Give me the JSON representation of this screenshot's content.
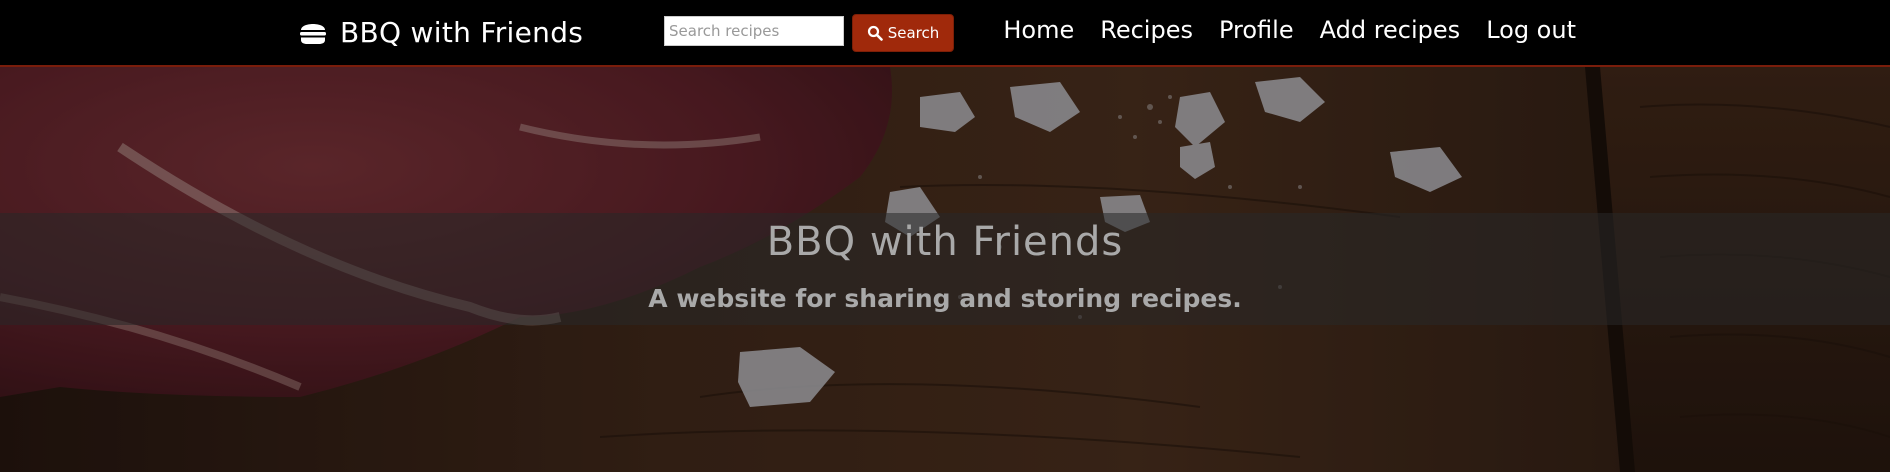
{
  "navbar": {
    "brand": {
      "icon": "hamburger-icon",
      "label": "BBQ with Friends"
    },
    "search": {
      "placeholder": "Search recipes",
      "value": "",
      "button_icon": "search-icon",
      "button_label": "Search"
    },
    "links": [
      {
        "label": "Home"
      },
      {
        "label": "Recipes"
      },
      {
        "label": "Profile"
      },
      {
        "label": "Add recipes"
      },
      {
        "label": "Log out"
      }
    ]
  },
  "hero": {
    "title": "BBQ with Friends",
    "subtitle": "A website for sharing and storing recipes."
  },
  "colors": {
    "navbar_bg": "#000000",
    "accent": "#a0290b",
    "hero_text": "#a9a9a9"
  }
}
